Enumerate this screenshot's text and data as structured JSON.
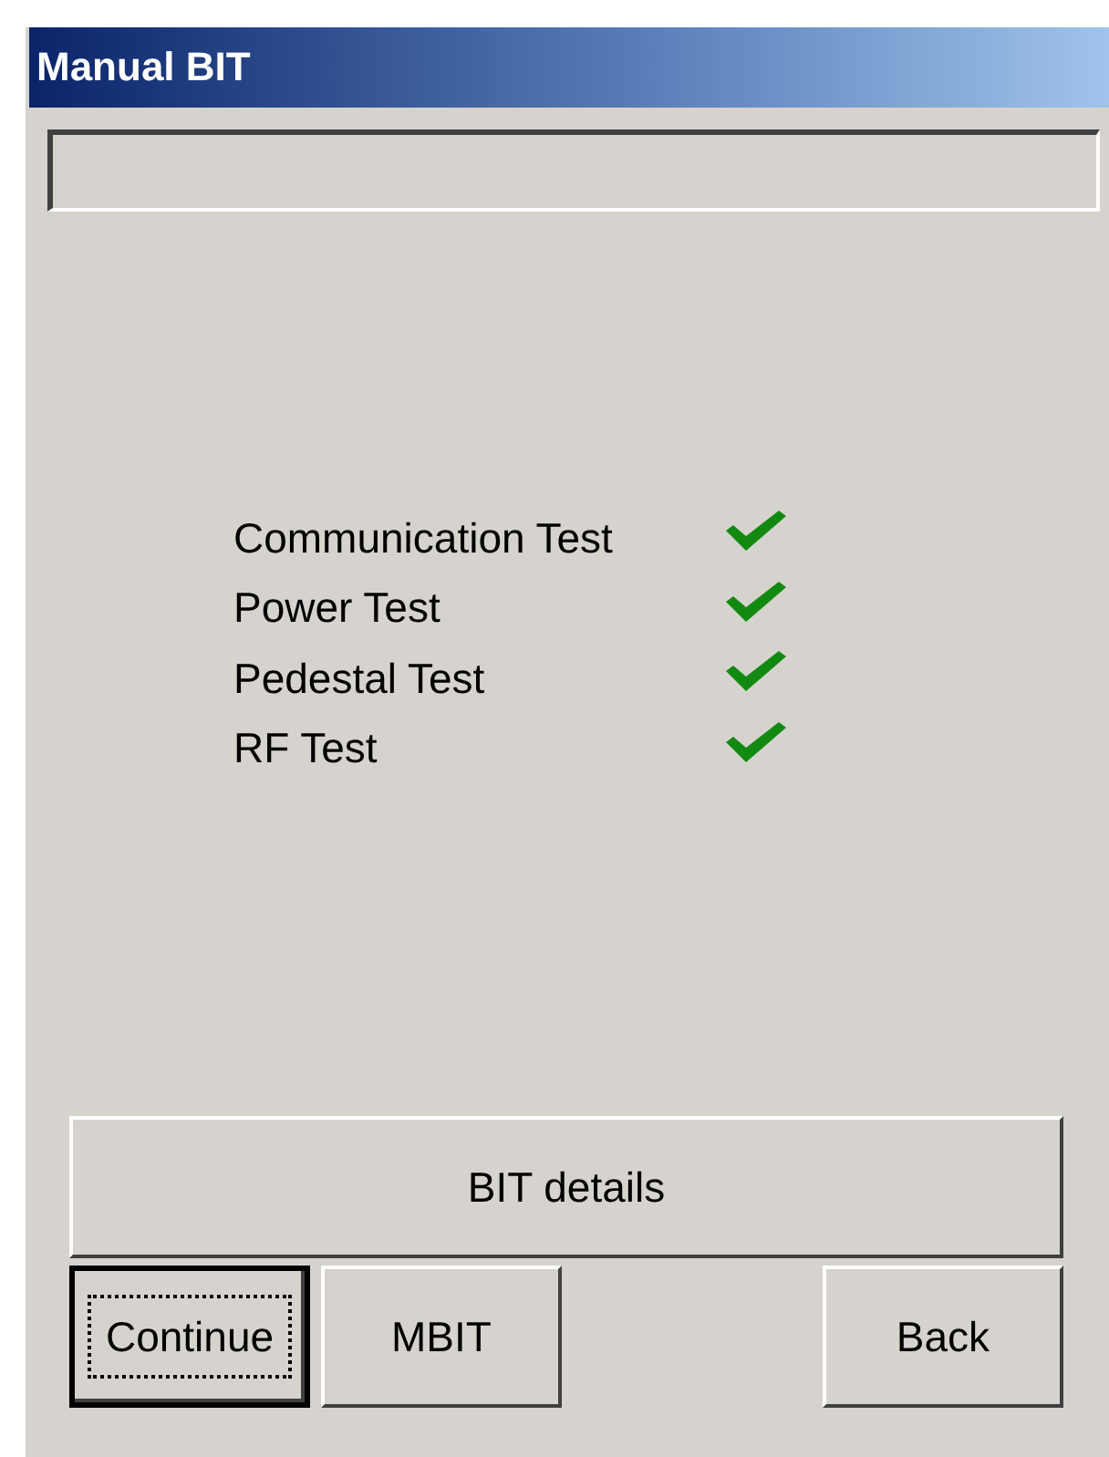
{
  "window": {
    "title": "Manual BIT"
  },
  "tests": [
    {
      "name": "Communication Test",
      "passed": true
    },
    {
      "name": "Power Test",
      "passed": true
    },
    {
      "name": "Pedestal Test",
      "passed": true
    },
    {
      "name": "RF Test",
      "passed": true
    }
  ],
  "details_button": {
    "label": "BIT details"
  },
  "buttons": [
    {
      "label": "Continue",
      "focused": true
    },
    {
      "label": "MBIT",
      "focused": false
    },
    {
      "label": "Back",
      "focused": false
    }
  ]
}
